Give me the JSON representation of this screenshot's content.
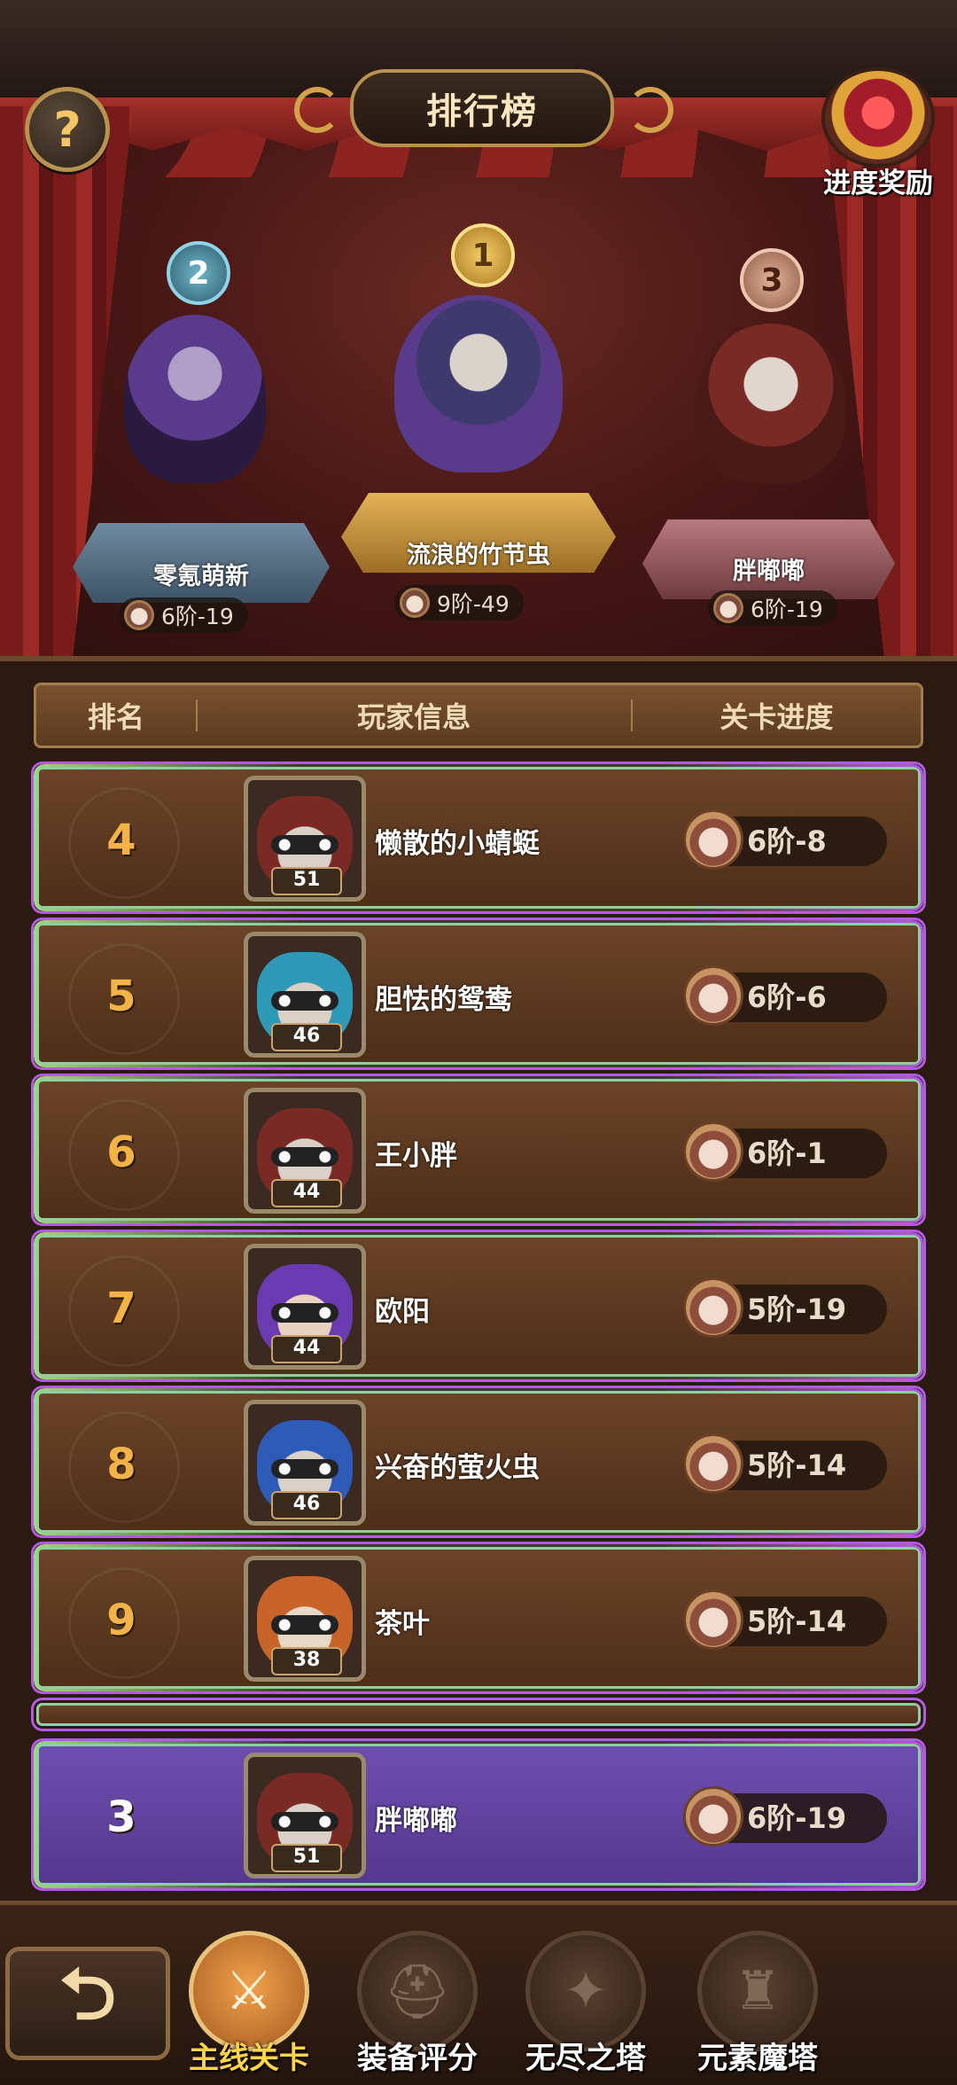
{
  "header": {
    "help_symbol": "?",
    "title": "排行榜",
    "reward_label": "进度奖励"
  },
  "podium": [
    {
      "rank": "2",
      "name": "零氪萌新",
      "progress": "6阶-19",
      "color": "#5a7a90"
    },
    {
      "rank": "1",
      "name": "流浪的竹节虫",
      "progress": "9阶-49",
      "color": "#c99a3a"
    },
    {
      "rank": "3",
      "name": "胖嘟嘟",
      "progress": "6阶-19",
      "color": "#9a5a5a"
    }
  ],
  "table": {
    "headers": [
      "排名",
      "玩家信息",
      "关卡进度"
    ],
    "rows": [
      {
        "rank": "4",
        "name": "懒散的小蜻蜓",
        "level": "51",
        "progress": "6阶-8",
        "avatar": "red-hood"
      },
      {
        "rank": "5",
        "name": "胆怯的鸳鸯",
        "level": "46",
        "progress": "6阶-6",
        "avatar": "teal-hood"
      },
      {
        "rank": "6",
        "name": "王小胖",
        "level": "44",
        "progress": "6阶-1",
        "avatar": "red-hood"
      },
      {
        "rank": "7",
        "name": "欧阳",
        "level": "44",
        "progress": "5阶-19",
        "avatar": "purple-hair"
      },
      {
        "rank": "8",
        "name": "兴奋的萤火虫",
        "level": "46",
        "progress": "5阶-14",
        "avatar": "blue-wizard"
      },
      {
        "rank": "9",
        "name": "茶叶",
        "level": "38",
        "progress": "5阶-14",
        "avatar": "orange-fox"
      }
    ]
  },
  "me": {
    "rank": "3",
    "name": "胖嘟嘟",
    "level": "51",
    "progress": "6阶-19",
    "avatar": "red-hood"
  },
  "nav": {
    "back_icon": "back-arrow-icon",
    "back_symbol": "⮌",
    "items": [
      {
        "label": "主线关卡",
        "icon": "crossed-swords-icon",
        "symbol": "⚔",
        "active": true
      },
      {
        "label": "装备评分",
        "icon": "helmet-icon",
        "symbol": "⛑",
        "active": false
      },
      {
        "label": "无尽之塔",
        "icon": "star-emblem-icon",
        "symbol": "✦",
        "active": false
      },
      {
        "label": "元素魔塔",
        "icon": "castle-tower-icon",
        "symbol": "♜",
        "active": false
      }
    ]
  },
  "colors": {
    "rank_gold": "#f3b346",
    "active_tab": "#ffd34a",
    "me_row": "#6e4fb0"
  }
}
